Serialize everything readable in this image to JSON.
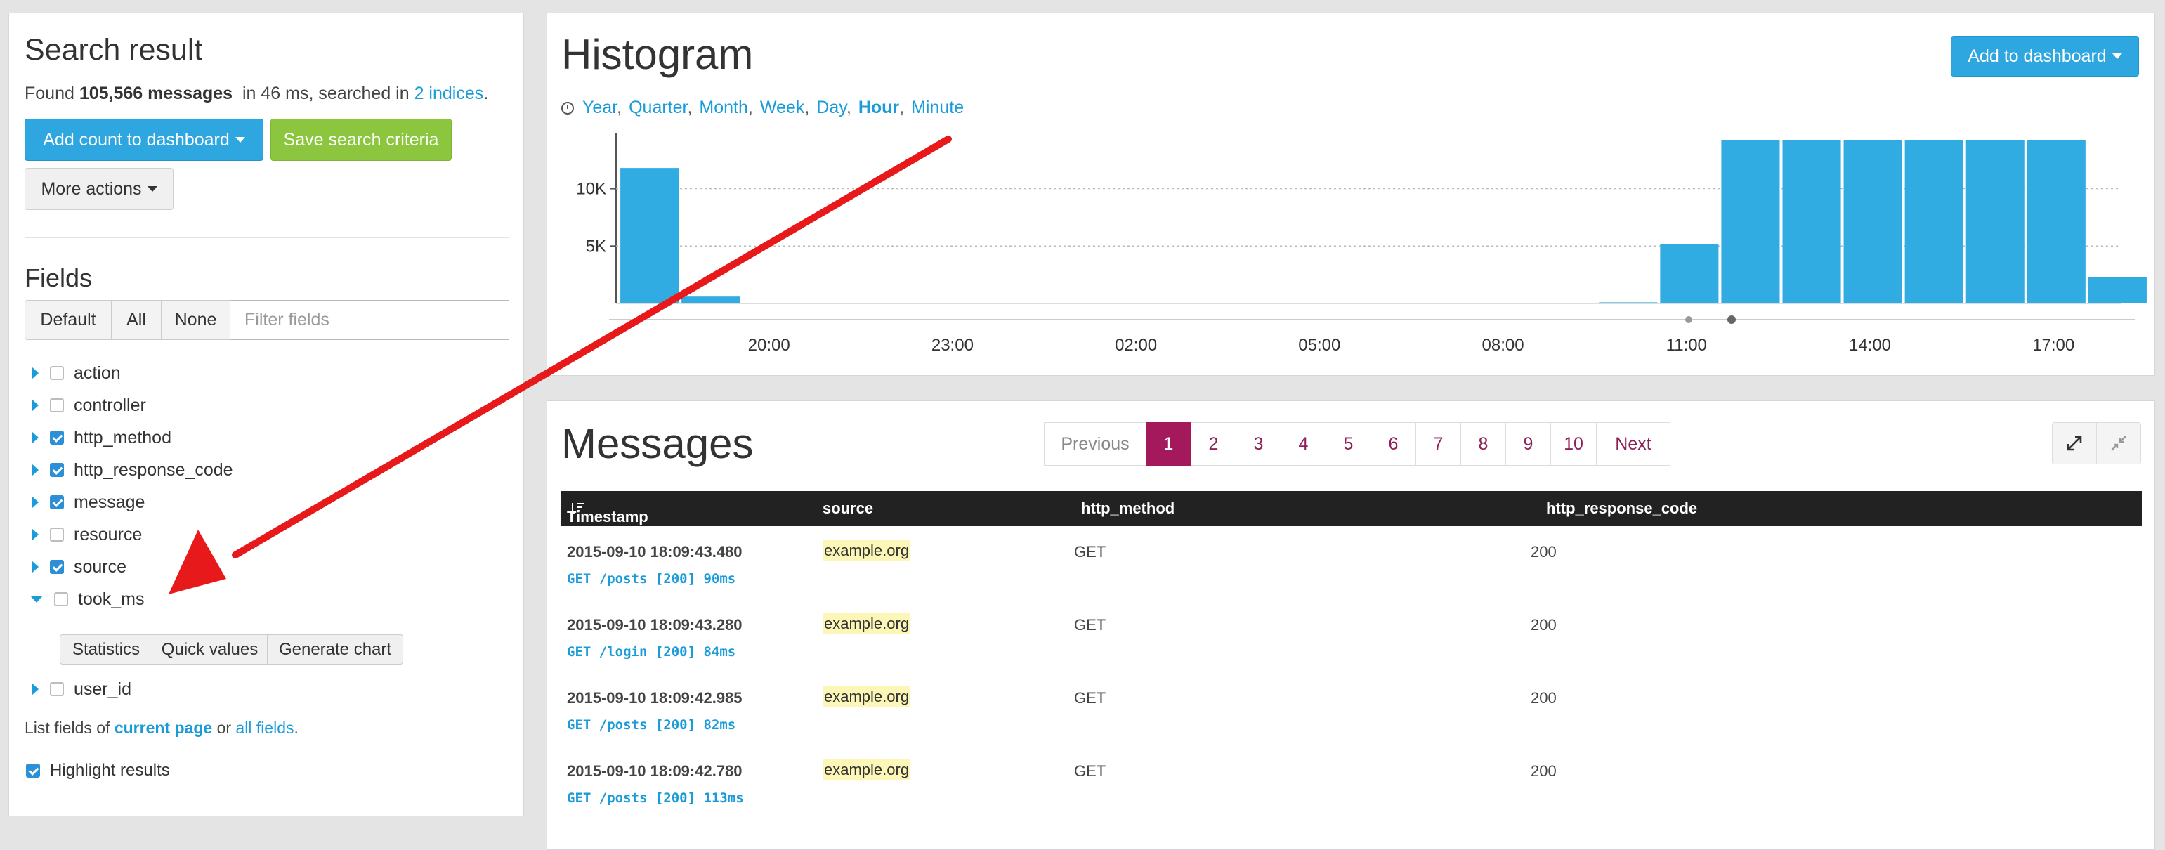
{
  "search": {
    "title": "Search result",
    "found_prefix": "Found",
    "count": "105,566 messages",
    "time_text": "in 46 ms, searched in",
    "indices_link": "2 indices",
    "period": ".",
    "add_count_label": "Add count to dashboard",
    "save_label": "Save search criteria",
    "more_actions_label": "More actions"
  },
  "fields": {
    "title": "Fields",
    "filter_buttons": [
      "Default",
      "All",
      "None"
    ],
    "filter_placeholder": "Filter fields",
    "items": [
      {
        "name": "action",
        "checked": false,
        "expanded": false
      },
      {
        "name": "controller",
        "checked": false,
        "expanded": false
      },
      {
        "name": "http_method",
        "checked": true,
        "expanded": false
      },
      {
        "name": "http_response_code",
        "checked": true,
        "expanded": false
      },
      {
        "name": "message",
        "checked": true,
        "expanded": false
      },
      {
        "name": "resource",
        "checked": false,
        "expanded": false
      },
      {
        "name": "source",
        "checked": true,
        "expanded": false
      },
      {
        "name": "took_ms",
        "checked": false,
        "expanded": true
      },
      {
        "name": "user_id",
        "checked": false,
        "expanded": false
      }
    ],
    "sub_actions": [
      "Statistics",
      "Quick values",
      "Generate chart"
    ],
    "list_fields_prefix": "List fields of",
    "current_page_link": "current page",
    "or_text": "or",
    "all_fields_link": "all fields",
    "highlight_label": "Highlight results"
  },
  "histogram": {
    "title": "Histogram",
    "ranges": [
      "Year",
      "Quarter",
      "Month",
      "Week",
      "Day",
      "Hour",
      "Minute"
    ],
    "active_range": "Hour",
    "add_to_dashboard": "Add to dashboard"
  },
  "chart_data": {
    "type": "bar",
    "title": "",
    "xlabel": "",
    "ylabel": "",
    "yticks": [
      "5K",
      "10K"
    ],
    "ylim": [
      0,
      14500
    ],
    "xlim": [
      17.5,
      18.4
    ],
    "xticks": [
      "20:00",
      "23:00",
      "02:00",
      "05:00",
      "08:00",
      "11:00",
      "14:00",
      "17:00"
    ],
    "bars": [
      {
        "x": 17.57,
        "value": 11800
      },
      {
        "x": 18.57,
        "value": 600
      },
      {
        "x": 33.57,
        "value": 100
      },
      {
        "x": 34.57,
        "value": 5200
      },
      {
        "x": 35.57,
        "value": 14200
      },
      {
        "x": 36.57,
        "value": 14200
      },
      {
        "x": 37.57,
        "value": 14200
      },
      {
        "x": 38.57,
        "value": 14200
      },
      {
        "x": 39.57,
        "value": 14200
      },
      {
        "x": 40.57,
        "value": 14200
      },
      {
        "x": 41.57,
        "value": 2300
      }
    ],
    "colors": {
      "bar": "#30ace2"
    }
  },
  "messages": {
    "title": "Messages",
    "prev_label": "Previous",
    "next_label": "Next",
    "pages": [
      "1",
      "2",
      "3",
      "4",
      "5",
      "6",
      "7",
      "8",
      "9",
      "10"
    ],
    "active_page": "1",
    "columns": [
      "Timestamp",
      "source",
      "http_method",
      "http_response_code"
    ],
    "rows": [
      {
        "timestamp": "2015-09-10 18:09:43.480",
        "message": "GET /posts [200] 90ms",
        "source": "example.org",
        "http_method": "GET",
        "http_response_code": "200"
      },
      {
        "timestamp": "2015-09-10 18:09:43.280",
        "message": "GET /login [200] 84ms",
        "source": "example.org",
        "http_method": "GET",
        "http_response_code": "200"
      },
      {
        "timestamp": "2015-09-10 18:09:42.985",
        "message": "GET /posts [200] 82ms",
        "source": "example.org",
        "http_method": "GET",
        "http_response_code": "200"
      },
      {
        "timestamp": "2015-09-10 18:09:42.780",
        "message": "GET /posts [200] 113ms",
        "source": "example.org",
        "http_method": "GET",
        "http_response_code": "200"
      }
    ]
  },
  "colors": {
    "accent": "#1b9cd8",
    "primary_button": "#2ea6df",
    "success_button": "#8cc63f",
    "pager_active": "#a3195b",
    "annotation_arrow": "#e8191a"
  }
}
